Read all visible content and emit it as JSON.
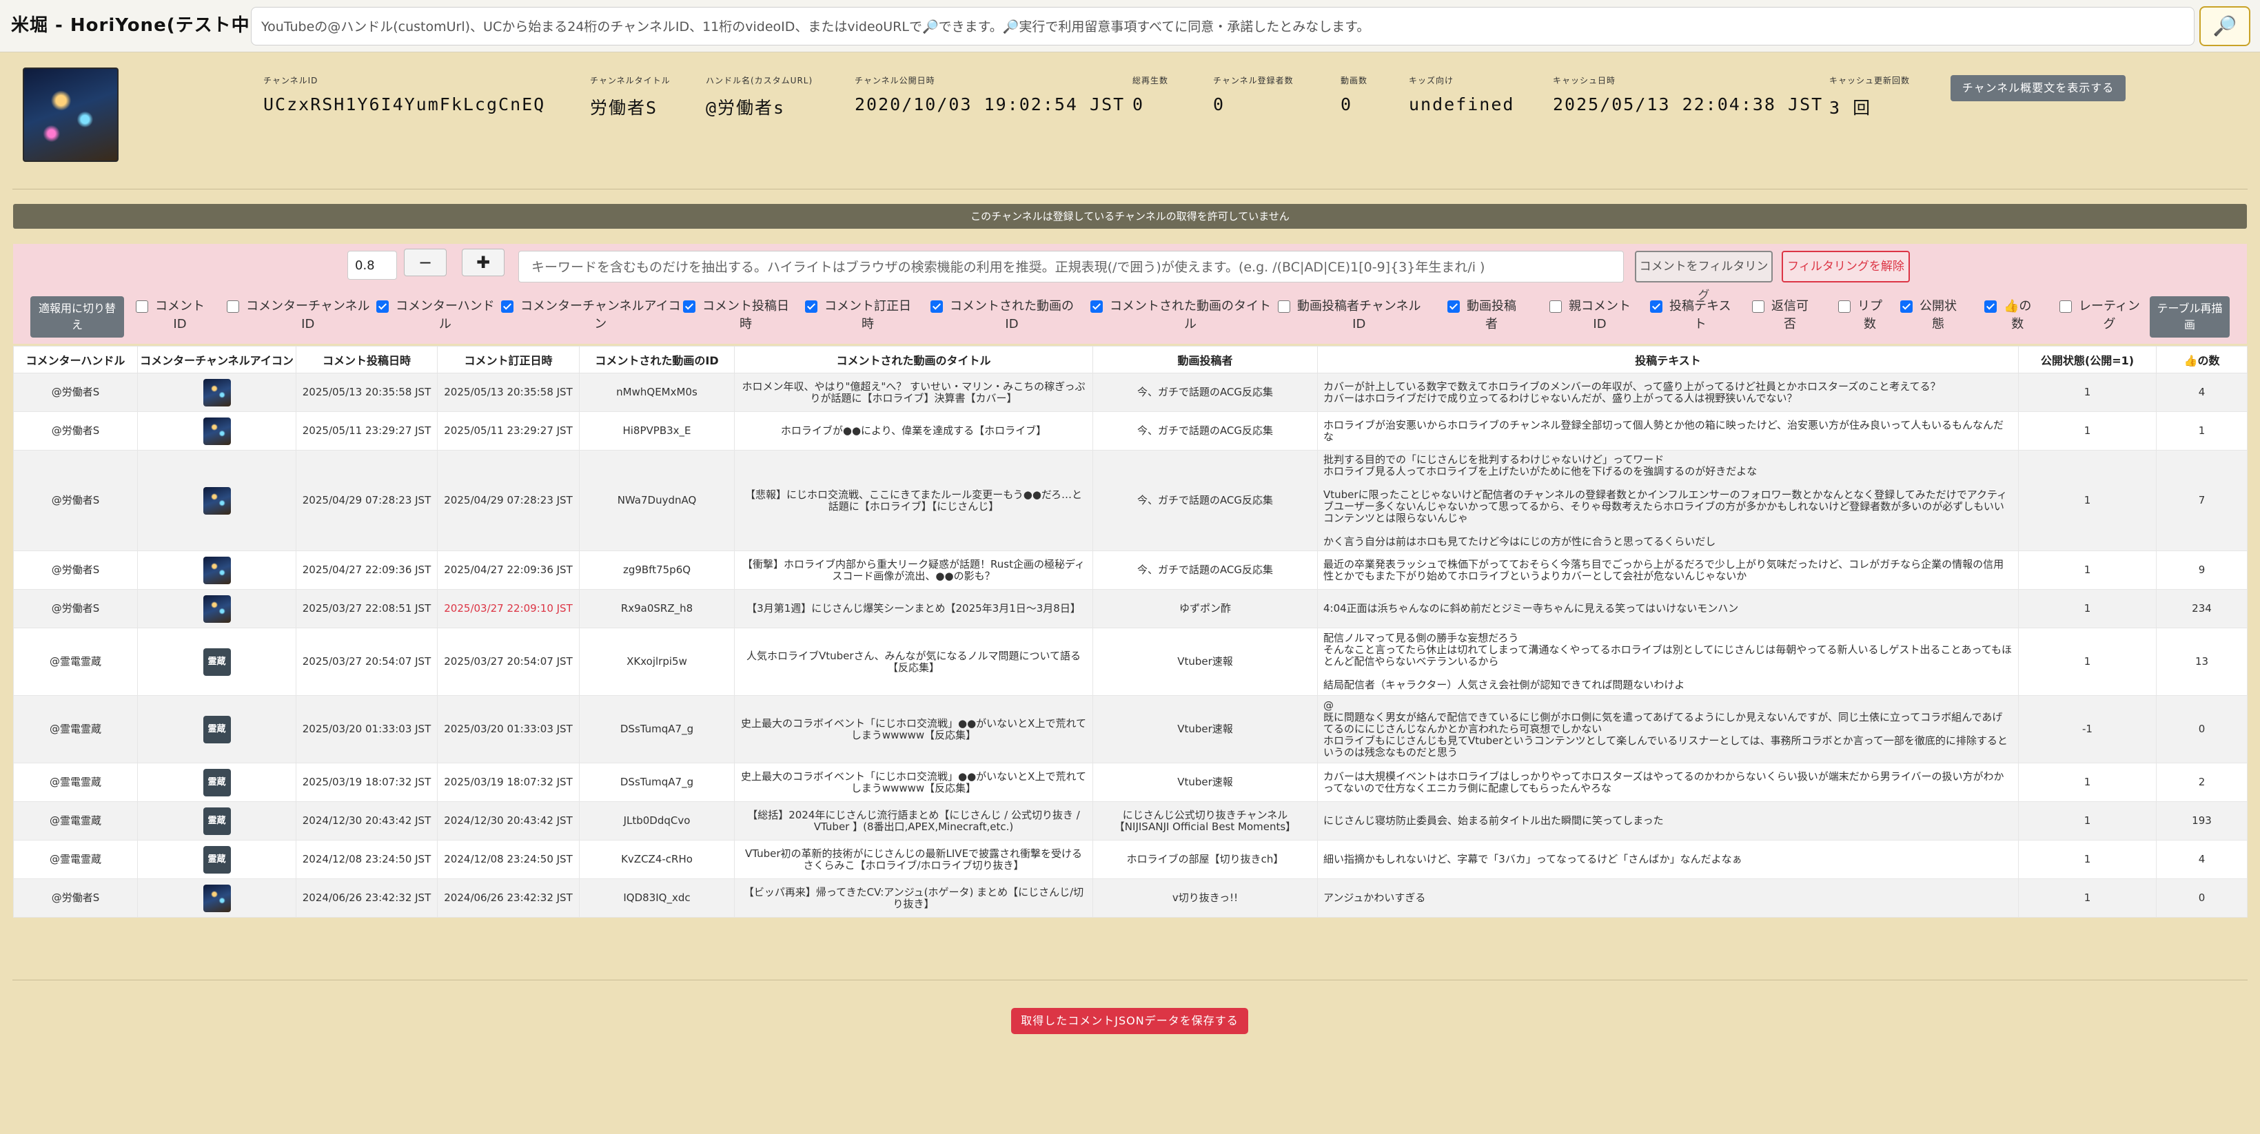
{
  "app": {
    "title": "米堀 - HoriYone(テスト中)"
  },
  "search": {
    "placeholder": "YouTubeの@ハンドル(customUrl)、UCから始まる24桁のチャンネルID、11桁のvideoID、またはvideoURLで🔎できます。🔎実行で利用留意事項すべてに同意・承諾したとみなします。",
    "button_icon": "🔎"
  },
  "channel": {
    "fields": [
      {
        "label": "チャンネルID",
        "value": "UCzxRSH1Y6I4YumFkLcgCnEQ"
      },
      {
        "label": "チャンネルタイトル",
        "value": "労働者S"
      },
      {
        "label": "ハンドル名(カスタムURL)",
        "value": "@労働者s"
      },
      {
        "label": "チャンネル公開日時",
        "value": "2020/10/03 19:02:54 JST"
      },
      {
        "label": "総再生数",
        "value": "0"
      },
      {
        "label": "チャンネル登録者数",
        "value": "0"
      },
      {
        "label": "動画数",
        "value": "0"
      },
      {
        "label": "キッズ向け",
        "value": "undefined"
      },
      {
        "label": "キャッシュ日時",
        "value": "2025/05/13 22:04:38 JST"
      },
      {
        "label": "キャッシュ更新回数",
        "value": "3 回"
      }
    ],
    "description_button": "チャンネル概要文を表示する"
  },
  "notice": "このチャンネルは登録しているチャンネルの取得を許可していません",
  "filter": {
    "scale_value": "0.8",
    "minus": "−",
    "plus": "✚",
    "keyword_placeholder": "キーワードを含むものだけを抽出する。ハイライトはブラウザの検索機能の利用を推奨。正規表現(/で囲う)が使えます。(e.g. /(BC|AD|CE)1[0-9]{3}年生まれ/i )",
    "filter_button": "コメントをフィルタリング",
    "unfilter_button": "フィルタリングを解除",
    "toggle_button": [
      "適報用に切り替",
      "え"
    ],
    "redraw_button": [
      "テーブル再描",
      "画"
    ],
    "columns": [
      {
        "lines": [
          "コメント",
          "ID"
        ],
        "checked": false
      },
      {
        "lines": [
          "コメンターチャンネル",
          "ID"
        ],
        "checked": false
      },
      {
        "lines": [
          "コメンターハンド",
          "ル"
        ],
        "checked": true
      },
      {
        "lines": [
          "コメンターチャンネルアイコ",
          "ン"
        ],
        "checked": true
      },
      {
        "lines": [
          "コメント投稿日",
          "時"
        ],
        "checked": true
      },
      {
        "lines": [
          "コメント訂正日",
          "時"
        ],
        "checked": true
      },
      {
        "lines": [
          "コメントされた動画の",
          "ID"
        ],
        "checked": true
      },
      {
        "lines": [
          "コメントされた動画のタイト",
          "ル"
        ],
        "checked": true
      },
      {
        "lines": [
          "動画投稿者チャンネル",
          "ID"
        ],
        "checked": false
      },
      {
        "lines": [
          "動画投稿",
          "者"
        ],
        "checked": true
      },
      {
        "lines": [
          "親コメント",
          "ID"
        ],
        "checked": false
      },
      {
        "lines": [
          "投稿テキス",
          "ト"
        ],
        "checked": true
      },
      {
        "lines": [
          "返信可",
          "否"
        ],
        "checked": false
      },
      {
        "lines": [
          "リプ",
          "数"
        ],
        "checked": false
      },
      {
        "lines": [
          "公開状",
          "態"
        ],
        "checked": true
      },
      {
        "lines": [
          "👍の",
          "数"
        ],
        "checked": true
      },
      {
        "lines": [
          "レーティン",
          "グ"
        ],
        "checked": false
      }
    ]
  },
  "table": {
    "headers": [
      "コメンターハンドル",
      "コメンターチャンネルアイコン",
      "コメント投稿日時",
      "コメント訂正日時",
      "コメントされた動画のID",
      "コメントされた動画のタイトル",
      "動画投稿者",
      "投稿テキスト",
      "公開状態(公開=1)",
      "👍の数"
    ],
    "rows": [
      {
        "handle": "@労働者S",
        "icon": "photo",
        "posted": "2025/05/13 20:35:58 JST",
        "edited": "2025/05/13 20:35:58 JST",
        "edited_red": false,
        "video_id": "nMwhQEMxM0s",
        "video_title": "ホロメン年収、やはり\"億超え\"へ？ すいせい・マリン・みこちの稼ぎっぷりが話題に【ホロライブ】決算書【カバー】",
        "uploader": "今、ガチで話題のACG反応集",
        "text": "カバーが計上している数字で数えてホロライブのメンバーの年収が、って盛り上がってるけど社員とかホロスターズのこと考えてる？\nカバーはホロライブだけで成り立ってるわけじゃないんだが、盛り上がってる人は視野狭いんでない？",
        "status": "1",
        "likes": "4"
      },
      {
        "handle": "@労働者S",
        "icon": "photo",
        "posted": "2025/05/11 23:29:27 JST",
        "edited": "2025/05/11 23:29:27 JST",
        "edited_red": false,
        "video_id": "Hi8PVPB3x_E",
        "video_title": "ホロライブが●●により、偉業を達成する【ホロライブ】",
        "uploader": "今、ガチで話題のACG反応集",
        "text": "ホロライブが治安悪いからホロライブのチャンネル登録全部切って個人勢とか他の箱に映ったけど、治安悪い方が住み良いって人もいるもんなんだな",
        "status": "1",
        "likes": "1"
      },
      {
        "handle": "@労働者S",
        "icon": "photo",
        "posted": "2025/04/29 07:28:23 JST",
        "edited": "2025/04/29 07:28:23 JST",
        "edited_red": false,
        "video_id": "NWa7DuydnAQ",
        "video_title": "【悲報】にじホロ交流戦、ここにきてまたルール変更ーもう●●だろ…と話題に【ホロライブ】【にじさんじ】",
        "uploader": "今、ガチで話題のACG反応集",
        "text": "批判する目的での「にじさんじを批判するわけじゃないけど」ってワード\nホロライブ見る人ってホロライブを上げたいがために他を下げるのを強調するのが好きだよな\n\nVtuberに限ったことじゃないけど配信者のチャンネルの登録者数とかインフルエンサーのフォロワー数とかなんとなく登録してみただけでアクティブユーザー多くないんじゃないかって思ってるから、そりゃ母数考えたらホロライブの方が多かかもしれないけど登録者数が多いのが必ずしもいいコンテンツとは限らないんじゃ\n\nかく言う自分は前はホロも見てたけど今はにじの方が性に合うと思ってるくらいだし",
        "status": "1",
        "likes": "7"
      },
      {
        "handle": "@労働者S",
        "icon": "photo",
        "posted": "2025/04/27 22:09:36 JST",
        "edited": "2025/04/27 22:09:36 JST",
        "edited_red": false,
        "video_id": "zg9Bft75p6Q",
        "video_title": "【衝撃】ホロライブ内部から重大リーク疑惑が話題！Rust企画の極秘ディスコード画像が流出、●●の影も？",
        "uploader": "今、ガチで話題のACG反応集",
        "text": "最近の卒業発表ラッシュで株価下がってておそらく今落ち目でごっから上がるだろで少し上がり気味だったけど、コレがガチなら企業の情報の信用性とかでもまた下がり始めてホロライブというよりカバーとして会社が危ないんじゃないか",
        "status": "1",
        "likes": "9"
      },
      {
        "handle": "@労働者S",
        "icon": "photo",
        "posted": "2025/03/27 22:08:51 JST",
        "edited": "2025/03/27 22:09:10 JST",
        "edited_red": true,
        "video_id": "Rx9a0SRZ_h8",
        "video_title": "【3月第1週】にじさんじ爆笑シーンまとめ【2025年3月1日～3月8日】",
        "uploader": "ゆずポン酢",
        "text": "4:04正面は浜ちゃんなのに斜め前だとジミー寺ちゃんに見える笑ってはいけないモンハン",
        "status": "1",
        "likes": "234"
      },
      {
        "handle": "@霊電霊蔵",
        "icon": "kanji",
        "posted": "2025/03/27 20:54:07 JST",
        "edited": "2025/03/27 20:54:07 JST",
        "edited_red": false,
        "video_id": "XKxojlrpi5w",
        "video_title": "人気ホロライブVtuberさん、みんなが気になるノルマ問題について語る【反応集】",
        "uploader": "Vtuber速報",
        "text": "配信ノルマって見る側の勝手な妄想だろう\nそんなこと言ってたら休止は切れてしまって溝通なくやってるホロライブは別としてにじさんじは毎朝やってる新人いるしゲスト出ることあってもほとんど配信やらないベテランいるから\n\n結局配信者（キャラクター）人気さえ会社側が認知できてれば問題ないわけよ",
        "status": "1",
        "likes": "13"
      },
      {
        "handle": "@霊電霊蔵",
        "icon": "kanji",
        "posted": "2025/03/20 01:33:03 JST",
        "edited": "2025/03/20 01:33:03 JST",
        "edited_red": false,
        "video_id": "DSsTumqA7_g",
        "video_title": "史上最大のコラボイベント「にじホロ交流戦」●●がいないとX上で荒れてしまうwwwww【反応集】",
        "uploader": "Vtuber速報",
        "text": "@\n既に問題なく男女が絡んで配信できているにじ側がホロ側に気を遣ってあげてるようにしか見えないんですが、同じ土俵に立ってコラボ組んであげてるのににじさんじなんかとか言われたら可哀想でしかない\nホロライブもにじさんじも見てVtuberというコンテンツとして楽しんでいるリスナーとしては、事務所コラボとか言って一部を徹底的に排除するというのは残念なものだと思う",
        "status": "-1",
        "likes": "0"
      },
      {
        "handle": "@霊電霊蔵",
        "icon": "kanji",
        "posted": "2025/03/19 18:07:32 JST",
        "edited": "2025/03/19 18:07:32 JST",
        "edited_red": false,
        "video_id": "DSsTumqA7_g",
        "video_title": "史上最大のコラボイベント「にじホロ交流戦」●●がいないとX上で荒れてしまうwwwww【反応集】",
        "uploader": "Vtuber速報",
        "text": "カバーは大規模イベントはホロライブはしっかりやってホロスターズはやってるのかわからないくらい扱いが端末だから男ライバーの扱い方がわかってないので仕方なくエニカラ側に配慮してもらったんやろな",
        "status": "1",
        "likes": "2"
      },
      {
        "handle": "@霊電霊蔵",
        "icon": "kanji",
        "posted": "2024/12/30 20:43:42 JST",
        "edited": "2024/12/30 20:43:42 JST",
        "edited_red": false,
        "video_id": "JLtb0DdqCvo",
        "video_title": "【総括】2024年にじさんじ流行語まとめ【にじさんじ / 公式切り抜き / VTuber 】(8番出口,APEX,Minecraft,etc.)",
        "uploader": "にじさんじ公式切り抜きチャンネル【NIJISANJI Official Best Moments】",
        "text": "にじさんじ寝坊防止委員会、始まる前タイトル出た瞬間に笑ってしまった",
        "status": "1",
        "likes": "193"
      },
      {
        "handle": "@霊電霊蔵",
        "icon": "kanji",
        "posted": "2024/12/08 23:24:50 JST",
        "edited": "2024/12/08 23:24:50 JST",
        "edited_red": false,
        "video_id": "KvZCZ4-cRHo",
        "video_title": "VTuber初の革新的技術がにじさんじの最新LIVEで披露され衝撃を受けるさくらみこ【ホロライブ/ホロライブ切り抜き】",
        "uploader": "ホロライブの部屋【切り抜きch】",
        "text": "細い指摘かもしれないけど、字幕で「3バカ」ってなってるけど「さんばか」なんだよなぁ",
        "status": "1",
        "likes": "4"
      },
      {
        "handle": "@労働者S",
        "icon": "photo",
        "posted": "2024/06/26 23:42:32 JST",
        "edited": "2024/06/26 23:42:32 JST",
        "edited_red": false,
        "video_id": "IQD83IQ_xdc",
        "video_title": "【ビッパ再来】帰ってきたCV:アンジュ(ホゲータ) まとめ【にじさんじ/切り抜き】",
        "uploader": "v切り抜きっ!!",
        "text": "アンジュかわいすぎる",
        "status": "1",
        "likes": "0"
      }
    ],
    "kanji_icon_text": "霊蔵"
  },
  "save_button": "取得したコメントJSONデータを保存する"
}
